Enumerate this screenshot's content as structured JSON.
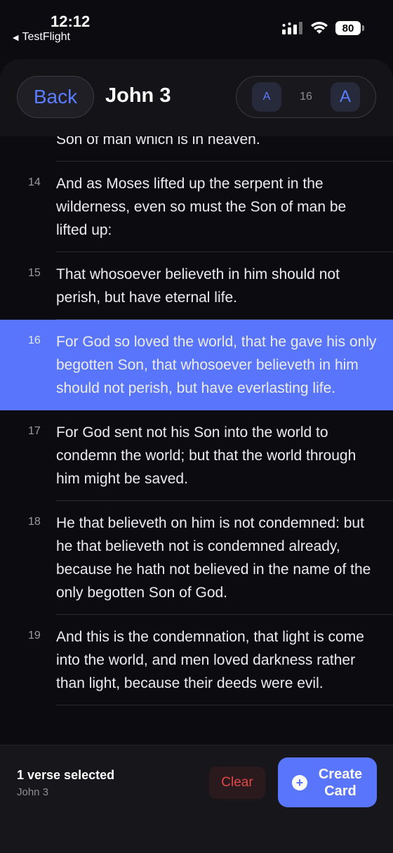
{
  "status_bar": {
    "time": "12:12",
    "back_app": "TestFlight",
    "battery": "80"
  },
  "header": {
    "back_label": "Back",
    "title": "John 3",
    "font_small_label": "A",
    "font_size_value": "16",
    "font_large_label": "A"
  },
  "verses": [
    {
      "number": "",
      "text": "but he that came down from heaven, even the Son of man which is in heaven."
    },
    {
      "number": "14",
      "text": "And as Moses lifted up the serpent in the wilderness, even so must the Son of man be lifted up:"
    },
    {
      "number": "15",
      "text": "That whosoever believeth in him should not perish, but have eternal life."
    },
    {
      "number": "16",
      "text": "For God so loved the world, that he gave his only begotten Son, that whosoever believeth in him should not perish, but have everlasting life."
    },
    {
      "number": "17",
      "text": "For God sent not his Son into the world to condemn the world; but that the world through him might be saved."
    },
    {
      "number": "18",
      "text": "He that believeth on him is not condemned: but he that believeth not is condemned already, because he hath not believed in the name of the only begotten Son of God."
    },
    {
      "number": "19",
      "text": "And this is the condemnation, that light is come into the world, and men loved darkness rather than light, because their deeds were evil."
    }
  ],
  "bottom_bar": {
    "selection_count": "1 verse selected",
    "selection_chapter": "John 3",
    "clear_label": "Clear",
    "create_card_label": "Create Card"
  },
  "colors": {
    "accent": "#5975fb",
    "background": "#0c0c10",
    "clear_text": "#e04848"
  }
}
